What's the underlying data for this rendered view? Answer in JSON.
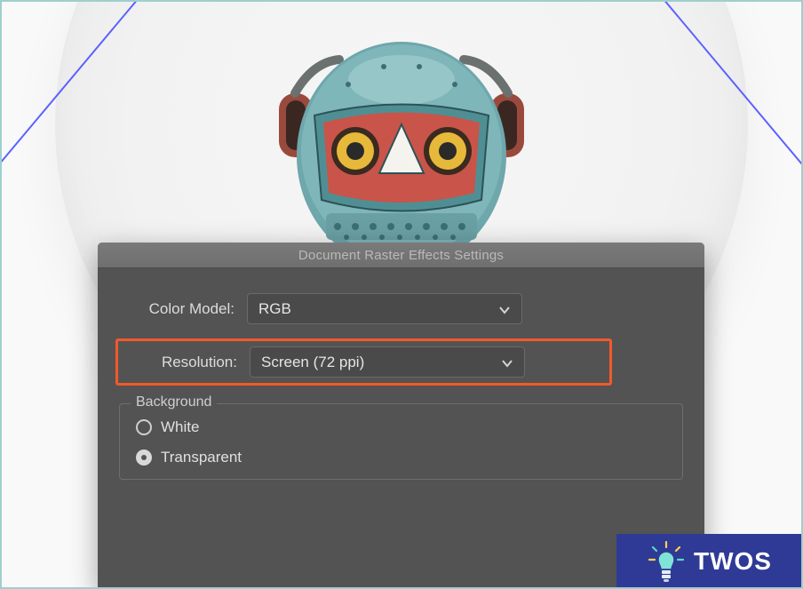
{
  "dialog": {
    "title": "Document Raster Effects Settings",
    "color_model": {
      "label": "Color Model:",
      "value": "RGB"
    },
    "resolution": {
      "label": "Resolution:",
      "value": "Screen (72 ppi)"
    },
    "background": {
      "legend": "Background",
      "options": [
        {
          "label": "White",
          "selected": false
        },
        {
          "label": "Transparent",
          "selected": true
        }
      ]
    }
  },
  "watermark": {
    "text": "TWOS"
  }
}
